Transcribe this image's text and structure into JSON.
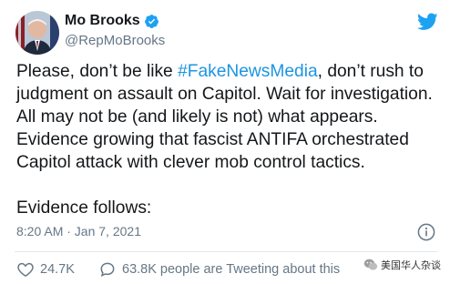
{
  "author": {
    "name": "Mo Brooks",
    "handle": "@RepMoBrooks"
  },
  "tweet": {
    "text_before_hashtag": "Please, don’t be like ",
    "hashtag": "#FakeNewsMedia",
    "text_after_hashtag": ", don’t rush to\njudgment on assault on Capitol. Wait for investigation.\nAll may not be (and likely is not) what appears.\nEvidence growing that fascist ANTIFA orchestrated\nCapitol attack with clever mob control tactics.\n\nEvidence follows:",
    "timestamp": "8:20 AM · Jan 7, 2021"
  },
  "actions": {
    "likes": "24.7K",
    "tweeting": "63.8K people are Tweeting about this"
  },
  "watermark": {
    "text": "美国华人杂谈"
  },
  "icons": {
    "verified": "verified-badge-icon",
    "bird": "twitter-bird-icon",
    "info": "info-icon",
    "like": "heart-icon",
    "reply": "reply-bubble-icon"
  },
  "colors": {
    "accent": "#1da1f2",
    "hashtag": "#1b95e0",
    "muted": "#657786"
  }
}
